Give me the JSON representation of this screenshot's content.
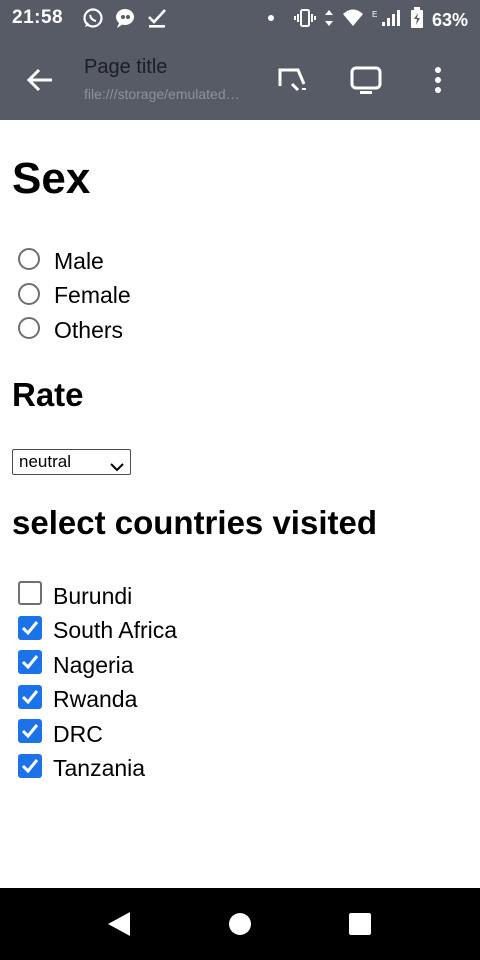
{
  "status_bar": {
    "time": "21:58",
    "battery": "63%",
    "left_icons": [
      "whatsapp-icon",
      "chat-bubble-icon",
      "check-icon"
    ],
    "right_icons": [
      "dot-icon",
      "vibrate-icon",
      "data-arrows-icon",
      "wifi-icon",
      "signal-icon",
      "battery-icon"
    ]
  },
  "toolbar": {
    "title": "Page title",
    "url": "file:///storage/emulated…",
    "icons": [
      "back-arrow-icon",
      "cast-icon",
      "desktop-icon",
      "more-vert-icon"
    ]
  },
  "form": {
    "sex_heading": "Sex",
    "sex_options": [
      {
        "label": "Male",
        "selected": false
      },
      {
        "label": "Female",
        "selected": false
      },
      {
        "label": "Others",
        "selected": false
      }
    ],
    "rate_heading": "Rate",
    "rate_select": {
      "value": "neutral"
    },
    "countries_heading": "select countries visited",
    "countries": [
      {
        "label": "Burundi",
        "checked": false
      },
      {
        "label": "South Africa",
        "checked": true
      },
      {
        "label": "Nageria",
        "checked": true
      },
      {
        "label": "Rwanda",
        "checked": true
      },
      {
        "label": "DRC",
        "checked": true
      },
      {
        "label": "Tanzania",
        "checked": true
      }
    ]
  },
  "nav_bar": {
    "buttons": [
      "back-triangle-icon",
      "home-circle-icon",
      "recents-square-icon"
    ]
  },
  "colors": {
    "bar_background": "#565b65",
    "checkbox_accent": "#1a73e8",
    "nav_background": "#000000"
  }
}
